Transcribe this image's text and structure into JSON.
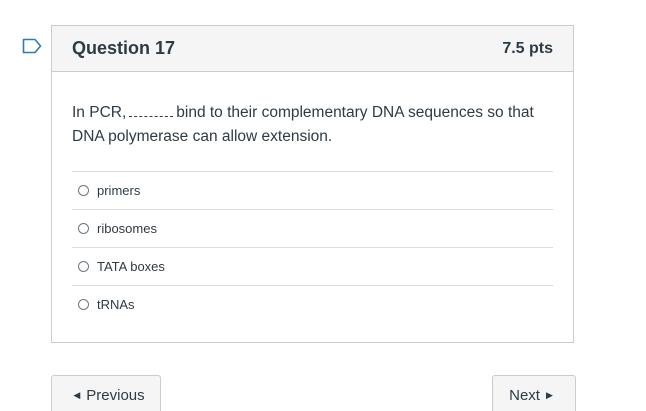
{
  "question": {
    "title": "Question 17",
    "points": "7.5 pts",
    "text_before": "In PCR,",
    "text_after": "bind to their complementary DNA sequences so that DNA polymerase can allow extension.",
    "answers": [
      {
        "label": "primers"
      },
      {
        "label": "ribosomes"
      },
      {
        "label": "TATA boxes"
      },
      {
        "label": "tRNAs"
      }
    ]
  },
  "navigation": {
    "previous_label": "Previous",
    "next_label": "Next",
    "previous_icon": "triangle-left-icon",
    "next_icon": "triangle-right-icon"
  },
  "flag": {
    "icon": "bookmark-flag-icon",
    "color": "#2b7abc"
  }
}
